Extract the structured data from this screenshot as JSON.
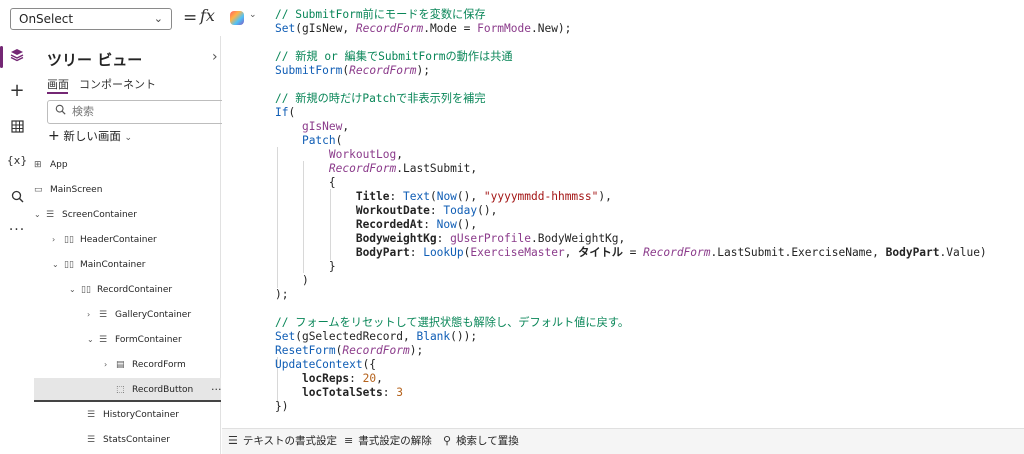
{
  "formula_bar": {
    "property": "OnSelect",
    "equals": "=",
    "fx": "fx"
  },
  "rail": {
    "icons": [
      "layers-icon",
      "plus-icon",
      "table-icon",
      "variables-icon",
      "search-icon",
      "more-icon"
    ],
    "variables_label": "{x}"
  },
  "tree": {
    "title": "ツリー ビュー",
    "tabs": [
      "画面",
      "コンポーネント"
    ],
    "search_placeholder": "検索",
    "new_screen": "新しい画面",
    "nodes": [
      {
        "label": "App"
      },
      {
        "label": "MainScreen"
      },
      {
        "label": "ScreenContainer"
      },
      {
        "label": "HeaderContainer"
      },
      {
        "label": "MainContainer"
      },
      {
        "label": "RecordContainer"
      },
      {
        "label": "GalleryContainer"
      },
      {
        "label": "FormContainer"
      },
      {
        "label": "RecordForm"
      },
      {
        "label": "RecordButton"
      },
      {
        "label": "HistoryContainer"
      },
      {
        "label": "StatsContainer"
      }
    ],
    "more": "···"
  },
  "code": {
    "c1": "// SubmitForm前にモードを変数に保存",
    "c2": "// 新規 or 編集でSubmitFormの動作は共通",
    "c3": "// 新規の時だけPatchで非表示列を補完",
    "c4": "// フォームをリセットして選択状態も解除し、デフォルト値に戻す。",
    "s_title": "\"yyyymmdd-hhmmss\"",
    "n_reps": "20",
    "n_sets": "3"
  },
  "bottom_bar": {
    "format": "テキストの書式設定",
    "unformat": "書式設定の解除",
    "find_replace": "検索して置換"
  }
}
